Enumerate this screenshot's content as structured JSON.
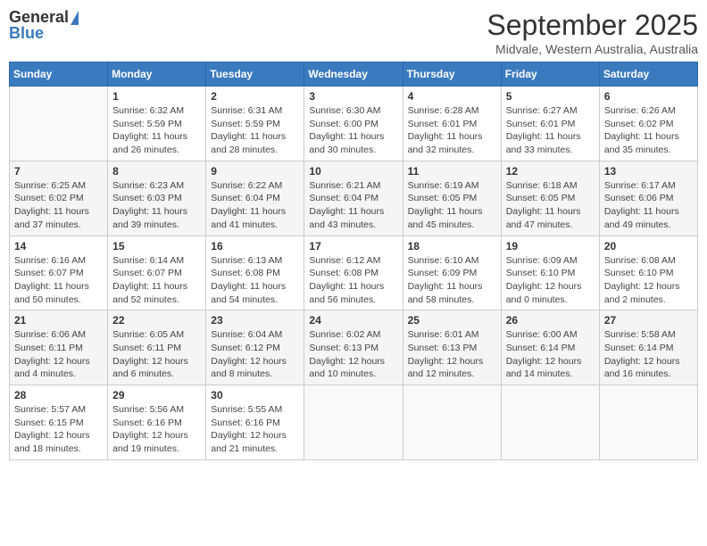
{
  "logo": {
    "general": "General",
    "blue": "Blue"
  },
  "title": "September 2025",
  "subtitle": "Midvale, Western Australia, Australia",
  "headers": [
    "Sunday",
    "Monday",
    "Tuesday",
    "Wednesday",
    "Thursday",
    "Friday",
    "Saturday"
  ],
  "weeks": [
    [
      {
        "day": "",
        "info": ""
      },
      {
        "day": "1",
        "info": "Sunrise: 6:32 AM\nSunset: 5:59 PM\nDaylight: 11 hours\nand 26 minutes."
      },
      {
        "day": "2",
        "info": "Sunrise: 6:31 AM\nSunset: 5:59 PM\nDaylight: 11 hours\nand 28 minutes."
      },
      {
        "day": "3",
        "info": "Sunrise: 6:30 AM\nSunset: 6:00 PM\nDaylight: 11 hours\nand 30 minutes."
      },
      {
        "day": "4",
        "info": "Sunrise: 6:28 AM\nSunset: 6:01 PM\nDaylight: 11 hours\nand 32 minutes."
      },
      {
        "day": "5",
        "info": "Sunrise: 6:27 AM\nSunset: 6:01 PM\nDaylight: 11 hours\nand 33 minutes."
      },
      {
        "day": "6",
        "info": "Sunrise: 6:26 AM\nSunset: 6:02 PM\nDaylight: 11 hours\nand 35 minutes."
      }
    ],
    [
      {
        "day": "7",
        "info": "Sunrise: 6:25 AM\nSunset: 6:02 PM\nDaylight: 11 hours\nand 37 minutes."
      },
      {
        "day": "8",
        "info": "Sunrise: 6:23 AM\nSunset: 6:03 PM\nDaylight: 11 hours\nand 39 minutes."
      },
      {
        "day": "9",
        "info": "Sunrise: 6:22 AM\nSunset: 6:04 PM\nDaylight: 11 hours\nand 41 minutes."
      },
      {
        "day": "10",
        "info": "Sunrise: 6:21 AM\nSunset: 6:04 PM\nDaylight: 11 hours\nand 43 minutes."
      },
      {
        "day": "11",
        "info": "Sunrise: 6:19 AM\nSunset: 6:05 PM\nDaylight: 11 hours\nand 45 minutes."
      },
      {
        "day": "12",
        "info": "Sunrise: 6:18 AM\nSunset: 6:05 PM\nDaylight: 11 hours\nand 47 minutes."
      },
      {
        "day": "13",
        "info": "Sunrise: 6:17 AM\nSunset: 6:06 PM\nDaylight: 11 hours\nand 49 minutes."
      }
    ],
    [
      {
        "day": "14",
        "info": "Sunrise: 6:16 AM\nSunset: 6:07 PM\nDaylight: 11 hours\nand 50 minutes."
      },
      {
        "day": "15",
        "info": "Sunrise: 6:14 AM\nSunset: 6:07 PM\nDaylight: 11 hours\nand 52 minutes."
      },
      {
        "day": "16",
        "info": "Sunrise: 6:13 AM\nSunset: 6:08 PM\nDaylight: 11 hours\nand 54 minutes."
      },
      {
        "day": "17",
        "info": "Sunrise: 6:12 AM\nSunset: 6:08 PM\nDaylight: 11 hours\nand 56 minutes."
      },
      {
        "day": "18",
        "info": "Sunrise: 6:10 AM\nSunset: 6:09 PM\nDaylight: 11 hours\nand 58 minutes."
      },
      {
        "day": "19",
        "info": "Sunrise: 6:09 AM\nSunset: 6:10 PM\nDaylight: 12 hours\nand 0 minutes."
      },
      {
        "day": "20",
        "info": "Sunrise: 6:08 AM\nSunset: 6:10 PM\nDaylight: 12 hours\nand 2 minutes."
      }
    ],
    [
      {
        "day": "21",
        "info": "Sunrise: 6:06 AM\nSunset: 6:11 PM\nDaylight: 12 hours\nand 4 minutes."
      },
      {
        "day": "22",
        "info": "Sunrise: 6:05 AM\nSunset: 6:11 PM\nDaylight: 12 hours\nand 6 minutes."
      },
      {
        "day": "23",
        "info": "Sunrise: 6:04 AM\nSunset: 6:12 PM\nDaylight: 12 hours\nand 8 minutes."
      },
      {
        "day": "24",
        "info": "Sunrise: 6:02 AM\nSunset: 6:13 PM\nDaylight: 12 hours\nand 10 minutes."
      },
      {
        "day": "25",
        "info": "Sunrise: 6:01 AM\nSunset: 6:13 PM\nDaylight: 12 hours\nand 12 minutes."
      },
      {
        "day": "26",
        "info": "Sunrise: 6:00 AM\nSunset: 6:14 PM\nDaylight: 12 hours\nand 14 minutes."
      },
      {
        "day": "27",
        "info": "Sunrise: 5:58 AM\nSunset: 6:14 PM\nDaylight: 12 hours\nand 16 minutes."
      }
    ],
    [
      {
        "day": "28",
        "info": "Sunrise: 5:57 AM\nSunset: 6:15 PM\nDaylight: 12 hours\nand 18 minutes."
      },
      {
        "day": "29",
        "info": "Sunrise: 5:56 AM\nSunset: 6:16 PM\nDaylight: 12 hours\nand 19 minutes."
      },
      {
        "day": "30",
        "info": "Sunrise: 5:55 AM\nSunset: 6:16 PM\nDaylight: 12 hours\nand 21 minutes."
      },
      {
        "day": "",
        "info": ""
      },
      {
        "day": "",
        "info": ""
      },
      {
        "day": "",
        "info": ""
      },
      {
        "day": "",
        "info": ""
      }
    ]
  ]
}
